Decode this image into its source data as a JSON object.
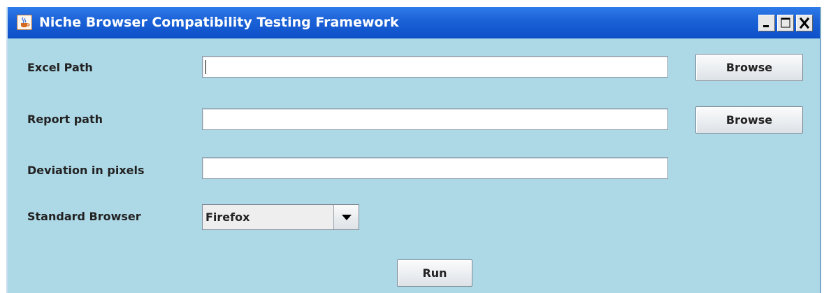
{
  "window": {
    "title": "Niche Browser Compatibility Testing Framework",
    "icon": "java-cup-icon",
    "controls": [
      "minimize-icon",
      "maximize-icon",
      "close-icon"
    ]
  },
  "form": {
    "excel_path": {
      "label": "Excel Path",
      "value": "",
      "browse_label": "Browse"
    },
    "report_path": {
      "label": "Report path",
      "value": "",
      "browse_label": "Browse"
    },
    "deviation": {
      "label": "Deviation in pixels",
      "value": ""
    },
    "standard_browser": {
      "label": "Standard Browser",
      "selected": "Firefox"
    },
    "run_label": "Run"
  },
  "colors": {
    "title_bar": "#1c63d8",
    "panel_background": "#add8e6"
  }
}
